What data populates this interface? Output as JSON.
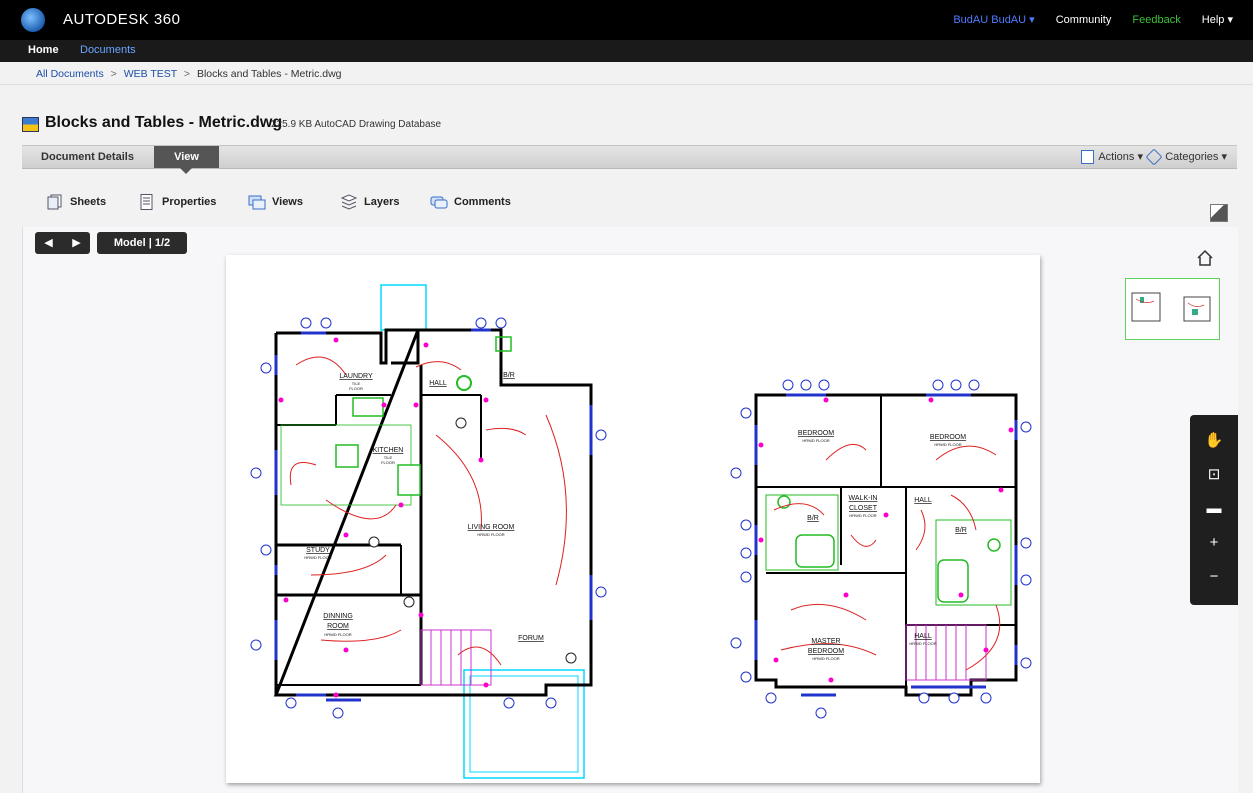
{
  "app": {
    "logo": "AUTODESK 360"
  },
  "topnav": {
    "user": "BudAU BudAU ▾",
    "community": "Community",
    "feedback": "Feedback",
    "help": "Help ▾"
  },
  "nav": {
    "home": "Home",
    "documents": "Documents"
  },
  "breadcrumb": [
    "All Documents",
    ">",
    "WEB TEST",
    ">",
    "Blocks and Tables - Metric.dwg"
  ],
  "document": {
    "title": "Blocks and Tables - Metric.dwg",
    "meta": "225.9 KB AutoCAD Drawing Database"
  },
  "tabs": {
    "details": "Document Details",
    "view": "View"
  },
  "menus": {
    "actions": "Actions ▾",
    "categories": "Categories ▾"
  },
  "tools": [
    "Sheets",
    "Properties",
    "Views",
    "Layers",
    "Comments"
  ],
  "viewer": {
    "prev": "◀",
    "next": "▶",
    "model": "Model  |  1/2"
  },
  "plan": {
    "rooms_left": [
      "LAUNDRY",
      "HALL",
      "B/R",
      "KITCHEN",
      "LIVING ROOM",
      "STUDY",
      "DINNING",
      "ROOM",
      "FORUM"
    ],
    "rooms_right": [
      "BEDROOM",
      "BEDROOM",
      "WALK-IN",
      "CLOSET",
      "HALL",
      "B/R",
      "B/R",
      "MASTER",
      "BEDROOM",
      "HALL"
    ],
    "floor_notes": {
      "tile": "TILE",
      "floor": "FLOOR",
      "hrwd": "HRWD FLOOR"
    }
  },
  "colors": {
    "accent": "#1b4fa8",
    "feedback": "#3fbf3f",
    "user": "#4f7cff",
    "wall": "#000000",
    "window": "#2233cc",
    "wiring": "#dd2222",
    "fixture": "#ff00cc",
    "cyan": "#00d8ff",
    "green": "#22bb22"
  }
}
